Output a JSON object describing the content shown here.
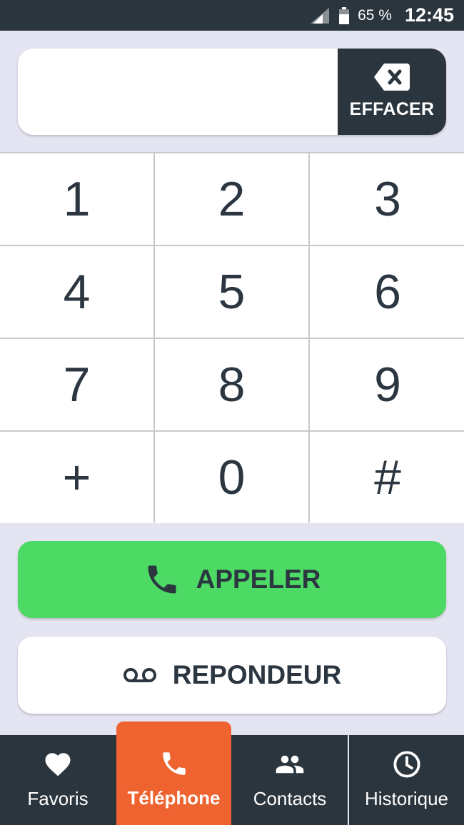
{
  "status_bar": {
    "battery_percent": "65 %",
    "time": "12:45",
    "icons": [
      "signal-icon",
      "battery-icon"
    ]
  },
  "dialer": {
    "number_value": "",
    "clear_label": "EFFACER",
    "clear_icon": "backspace-icon"
  },
  "keypad": {
    "keys": [
      "1",
      "2",
      "3",
      "4",
      "5",
      "6",
      "7",
      "8",
      "9",
      "+",
      "0",
      "#"
    ]
  },
  "actions": {
    "call_label": "APPELER",
    "call_icon": "phone-icon",
    "voicemail_label": "REPONDEUR",
    "voicemail_icon": "voicemail-icon"
  },
  "bottom_nav": {
    "items": [
      {
        "label": "Favoris",
        "icon": "heart-icon",
        "active": false
      },
      {
        "label": "Téléphone",
        "icon": "phone-icon",
        "active": true
      },
      {
        "label": "Contacts",
        "icon": "people-icon",
        "active": false
      },
      {
        "label": "Historique",
        "icon": "clock-icon",
        "active": false
      }
    ]
  },
  "colors": {
    "background": "#e4e4f2",
    "dark": "#2b353d",
    "call_green": "#4cd964",
    "active_orange": "#ee6330",
    "text": "#2b3640"
  }
}
